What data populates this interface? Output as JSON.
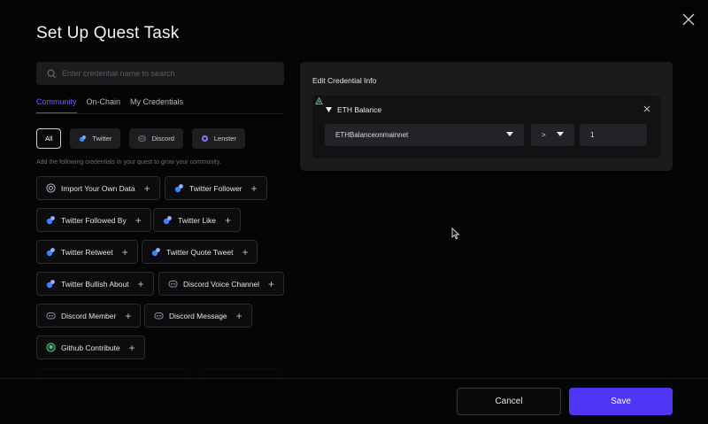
{
  "modal": {
    "title": "Set Up Quest Task",
    "close_icon": "close-icon"
  },
  "search": {
    "placeholder": "Enter credential name to search",
    "value": ""
  },
  "tabs": [
    {
      "label": "Community",
      "active": true
    },
    {
      "label": "On-Chain",
      "active": false
    },
    {
      "label": "My Credentials",
      "active": false
    }
  ],
  "filters": [
    {
      "label": "All",
      "icon": "",
      "active": true
    },
    {
      "label": "Twitter",
      "icon": "twitter-icon",
      "active": false
    },
    {
      "label": "Discord",
      "icon": "discord-icon",
      "active": false
    },
    {
      "label": "Lenster",
      "icon": "lenster-icon",
      "active": false
    }
  ],
  "hint": "Add the following credentials in your quest to grow your community.",
  "credentials": [
    {
      "label": "Import Your Own Data",
      "icon": "import-data-icon"
    },
    {
      "label": "Twitter Follower",
      "icon": "twitter-icon"
    },
    {
      "label": "Twitter Followed By",
      "icon": "twitter-icon"
    },
    {
      "label": "Twitter Like",
      "icon": "twitter-icon"
    },
    {
      "label": "Twitter Retweet",
      "icon": "twitter-icon"
    },
    {
      "label": "Twitter Quote Tweet",
      "icon": "twitter-icon"
    },
    {
      "label": "Twitter Bullish About",
      "icon": "twitter-icon"
    },
    {
      "label": "Discord Voice Channel",
      "icon": "discord-icon"
    },
    {
      "label": "Discord Member",
      "icon": "discord-icon"
    },
    {
      "label": "Discord Message",
      "icon": "discord-icon"
    },
    {
      "label": "Github Contribute",
      "icon": "github-icon"
    }
  ],
  "edit": {
    "title": "Edit Credential Info",
    "credential_name": "ETH Balance",
    "network_select": "ETHBalanceonmainnet",
    "operator_select": ">",
    "amount_value": "1"
  },
  "footer": {
    "cancel_label": "Cancel",
    "save_label": "Save"
  },
  "colors": {
    "accent": "#4f36f5",
    "tab_active": "#6b5cff",
    "background": "#050505",
    "card": "#1b1b1e"
  }
}
